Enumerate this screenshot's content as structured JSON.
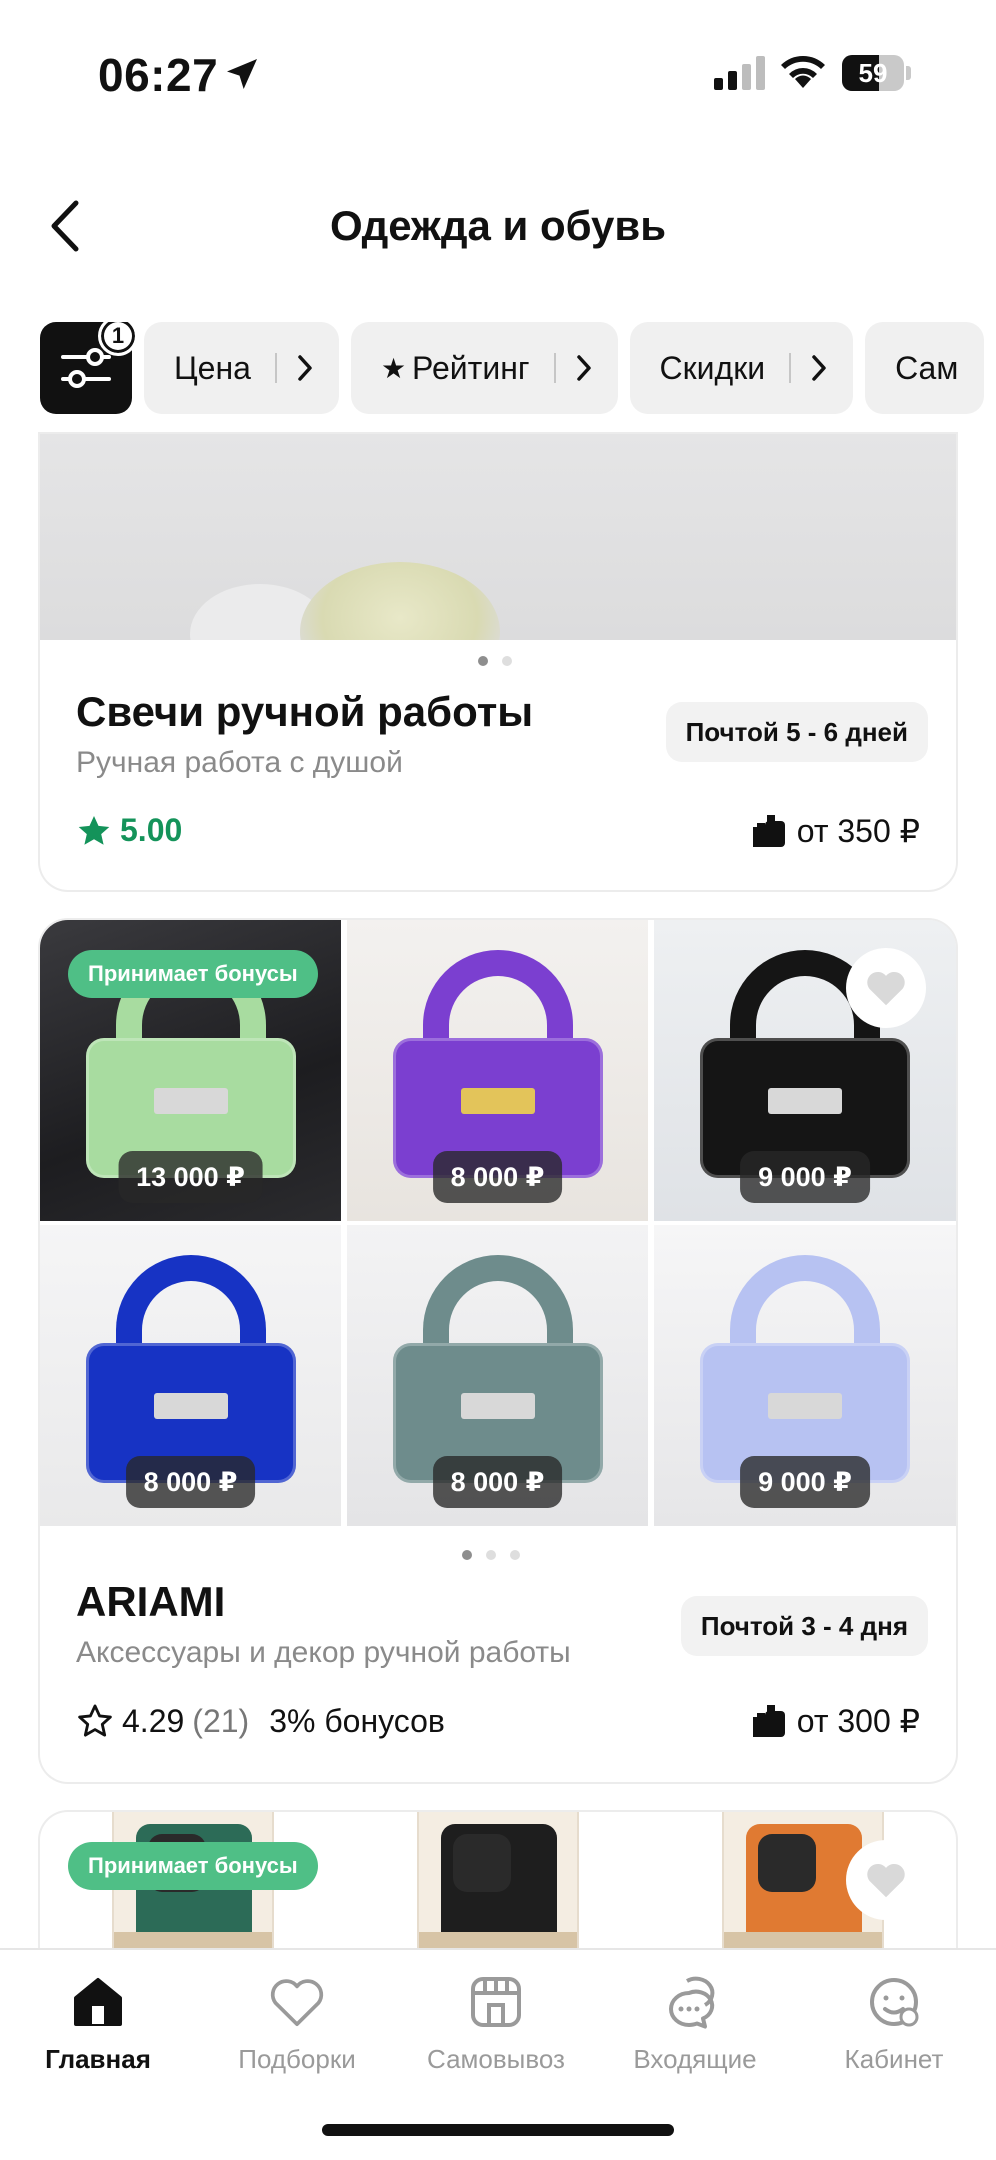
{
  "status_bar": {
    "time": "06:27",
    "battery": "59",
    "battery_level": 0.59
  },
  "header": {
    "title": "Одежда и обувь"
  },
  "filters": {
    "active_count": "1",
    "chips": [
      {
        "label": "Цена"
      },
      {
        "label": "Рейтинг",
        "star": "★"
      },
      {
        "label": "Скидки"
      },
      {
        "label": "Сам"
      }
    ]
  },
  "shops": [
    {
      "name": "Свечи ручной работы",
      "subtitle": "Ручная работа с душой",
      "shipping": "Почтой 5 - 6 дней",
      "rating": "5.00",
      "price": "от 350 ₽"
    },
    {
      "name": "ARIAMI",
      "subtitle": "Аксессуары и декор ручной работы",
      "shipping": "Почтой 3 - 4 дня",
      "rating": "4.29",
      "reviews": "(21)",
      "bonus": "3% бонусов",
      "price": "от 300 ₽",
      "bonus_badge": "Принимает бонусы",
      "items": [
        {
          "price": "13 000 ₽",
          "color": "#a8dca0"
        },
        {
          "price": "8 000 ₽",
          "color": "#7b3fd0"
        },
        {
          "price": "9 000 ₽",
          "color": "#151515"
        },
        {
          "price": "8 000 ₽",
          "color": "#1733c4"
        },
        {
          "price": "8 000 ₽",
          "color": "#6e8c8c"
        },
        {
          "price": "9 000 ₽",
          "color": "#b7c2f2"
        }
      ]
    },
    {
      "bonus_badge": "Принимает бонусы",
      "items": [
        {
          "color": "#2c6b57"
        },
        {
          "color": "#1e1e1e"
        },
        {
          "color": "#e07a32"
        }
      ]
    }
  ],
  "tabbar": {
    "tabs": [
      {
        "label": "Главная",
        "icon": "home-icon"
      },
      {
        "label": "Подборки",
        "icon": "heart-icon"
      },
      {
        "label": "Самовывоз",
        "icon": "store-icon"
      },
      {
        "label": "Входящие",
        "icon": "chat-icon"
      },
      {
        "label": "Кабинет",
        "icon": "profile-icon"
      }
    ],
    "active_index": 0
  },
  "colors": {
    "accent_green": "#14935a",
    "bonus_green": "#4fbf86"
  }
}
